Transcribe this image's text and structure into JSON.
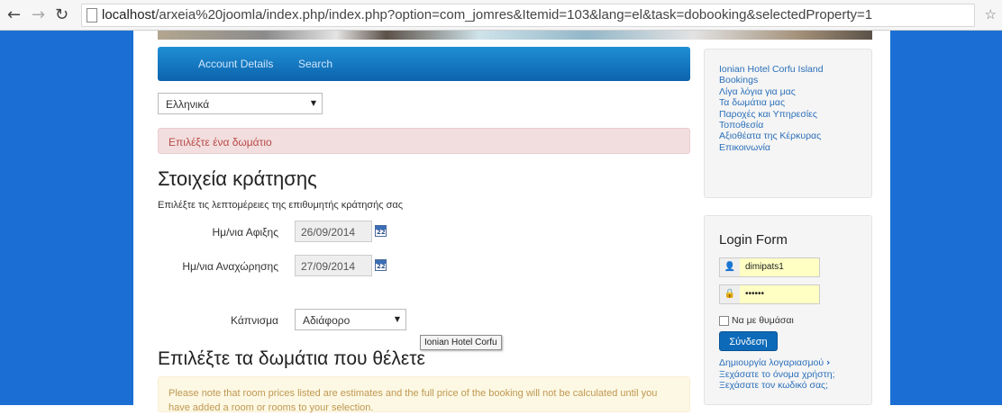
{
  "browser": {
    "url_host": "localhost",
    "url_path": "/arxeia%20joomla/index.php/index.php?option=com_jomres&Itemid=103&lang=el&task=dobooking&selectedProperty=1",
    "back_icon": "back-arrow-icon",
    "forward_icon": "forward-arrow-icon",
    "reload_icon": "reload-icon"
  },
  "menu": {
    "items": [
      {
        "label": "Account Details"
      },
      {
        "label": "Search"
      }
    ]
  },
  "language_select": {
    "value": "Ελληνικά"
  },
  "alert": {
    "text": "Επιλέξτε ένα δωμάτιο"
  },
  "booking": {
    "title": "Στοιχεία κράτησης",
    "subtitle": "Επιλέξτε τις λεπτομέρειες της επιθυμητής κράτησής σας",
    "arrival_label": "Ημ/νια Αφιξης",
    "arrival_value": "26/09/2014",
    "departure_label": "Ημ/νια Αναχώρησης",
    "departure_value": "27/09/2014",
    "calendar_day": "22",
    "smoking_label": "Κάπνισμα",
    "smoking_value": "Αδιάφορο"
  },
  "tooltip": {
    "text": "Ionian Hotel Corfu"
  },
  "rooms": {
    "title": "Επιλέξτε τα δωμάτια που θέλετε",
    "note": "Please note that room prices listed are estimates and the full price of the booking will not be calculated until you have added a room or rooms to your selection."
  },
  "sidebar": {
    "links": [
      {
        "label": "Ionian Hotel Corfu Island"
      },
      {
        "label": "Bookings"
      },
      {
        "label": "Λίγα λόγια για μας"
      },
      {
        "label": "Τα δωμάτια μας"
      },
      {
        "label": "Παροχές και Υπηρεσίες"
      },
      {
        "label": "Τοποθεσία"
      },
      {
        "label": "Αξιοθέατα της Κέρκυρας"
      },
      {
        "label": "Επικοινωνία"
      }
    ]
  },
  "login": {
    "title": "Login Form",
    "username": "dimipats1",
    "password": "••••••",
    "remember_label": "Να με θυμάσαι",
    "button": "Σύνδεση",
    "create_account": "Δημιουργία λογαριασμού",
    "forgot_username": "Ξεχάσατε το όνομα χρήστη;",
    "forgot_password": "Ξεχάσατε τον κωδικό σας;"
  },
  "colors": {
    "page_background": "#1b6fd4",
    "menu_bar": "#0c63ac",
    "link": "#2a6fb8",
    "alert_text": "#b94a48",
    "note_text": "#c09853"
  }
}
